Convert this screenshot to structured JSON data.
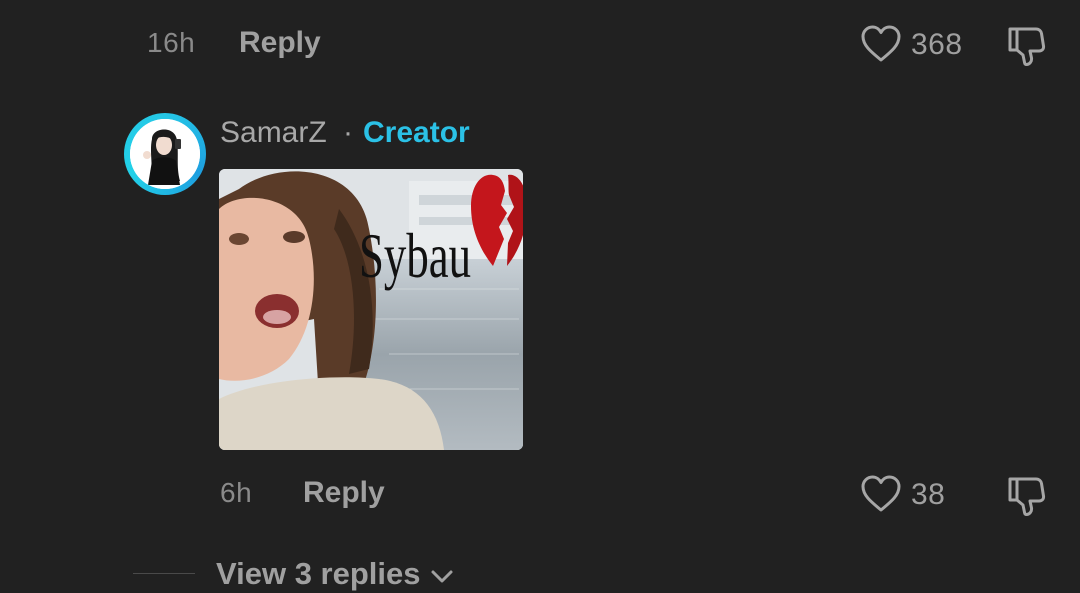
{
  "top_comment": {
    "time": "16h",
    "reply_label": "Reply",
    "like_count": "368"
  },
  "reply_comment": {
    "username": "SamarZ",
    "separator": "·",
    "badge": "Creator",
    "media_caption": "Sybau",
    "time": "6h",
    "reply_label": "Reply",
    "like_count": "38"
  },
  "view_replies": {
    "label": "View 3 replies"
  },
  "colors": {
    "background": "#212121",
    "creator_accent": "#2bc1e6",
    "text_muted": "#a0a0a0"
  },
  "icons": {
    "like": "heart-outline-icon",
    "dislike": "thumbs-down-icon",
    "expand": "chevron-down-icon"
  }
}
